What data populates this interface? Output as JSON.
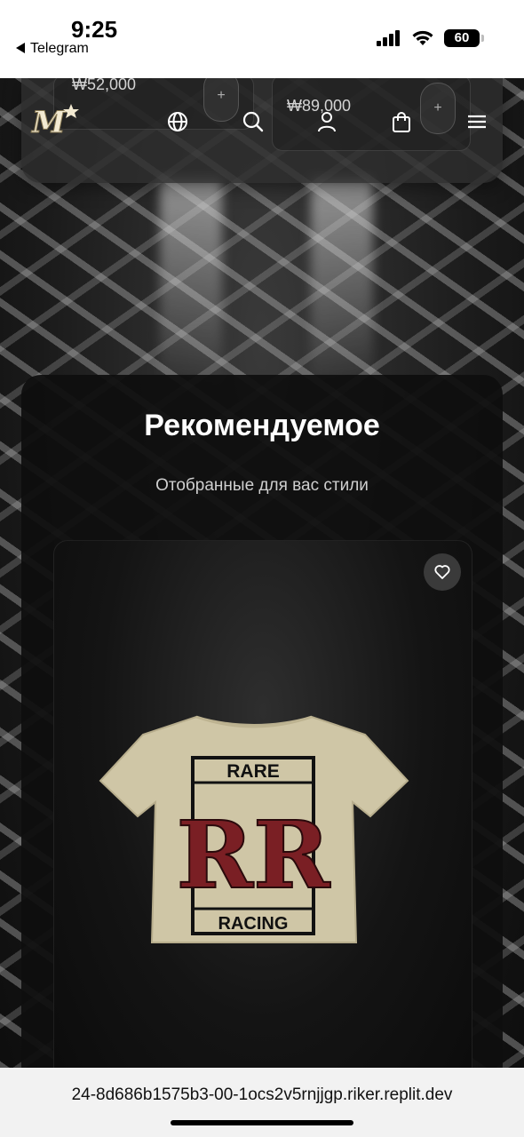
{
  "status_bar": {
    "time": "9:25",
    "back_app": "Telegram",
    "battery": "60"
  },
  "header": {
    "logo_text": "M",
    "background_cards": [
      {
        "price": "₩52,000",
        "add_label": "+"
      },
      {
        "price": "₩89,000",
        "add_label": "+"
      }
    ],
    "icons": [
      "globe-icon",
      "search-icon",
      "user-icon",
      "bag-icon",
      "menu-icon"
    ]
  },
  "section": {
    "title": "Рекомендуемое",
    "subtitle": "Отобранные для вас стили"
  },
  "product": {
    "print_top": "RARE",
    "print_monogram": "RR",
    "print_bottom": "RACING",
    "tee_color": "#cfc6a6",
    "print_color": "#7a1f24"
  },
  "browser": {
    "url": "24-8d686b1575b3-00-1ocs2v5rnjjgp.riker.replit.dev"
  }
}
